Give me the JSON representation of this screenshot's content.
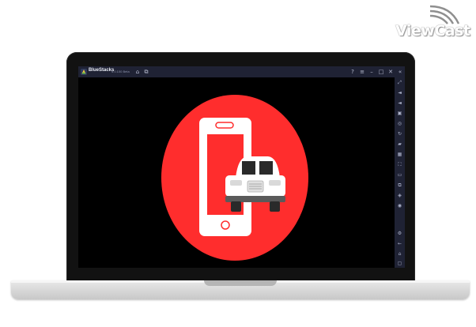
{
  "watermark": {
    "text": "ViewCast"
  },
  "window": {
    "app_name": "BlueStacks",
    "version": "5.0.100 Beta",
    "title_icons": [
      "home-icon",
      "multi-instance-icon"
    ],
    "controls": [
      "help-icon",
      "menu-icon",
      "minimize-icon",
      "maximize-icon",
      "close-icon",
      "collapse-sidebar-icon"
    ]
  },
  "sidebar": {
    "items": [
      "fullscreen-icon",
      "volume-up-icon",
      "volume-down-icon",
      "media-icon",
      "screenshot-icon",
      "rotate-icon",
      "car-icon",
      "apk-icon",
      "macro-icon",
      "folder-icon",
      "copy-icon",
      "layers-icon",
      "eco-mode-icon",
      "settings-icon",
      "back-icon",
      "android-home-icon",
      "recent-apps-icon"
    ]
  },
  "app_content": {
    "description": "red circle logo with a smartphone and a white car",
    "colors": {
      "circle": "#ff2d2d",
      "phone": "#ffffff",
      "car": "#ffffff",
      "background": "#000000"
    }
  },
  "colors": {
    "titlebar": "#1f2234",
    "lid": "#121212",
    "base": "#d4d4d4"
  }
}
